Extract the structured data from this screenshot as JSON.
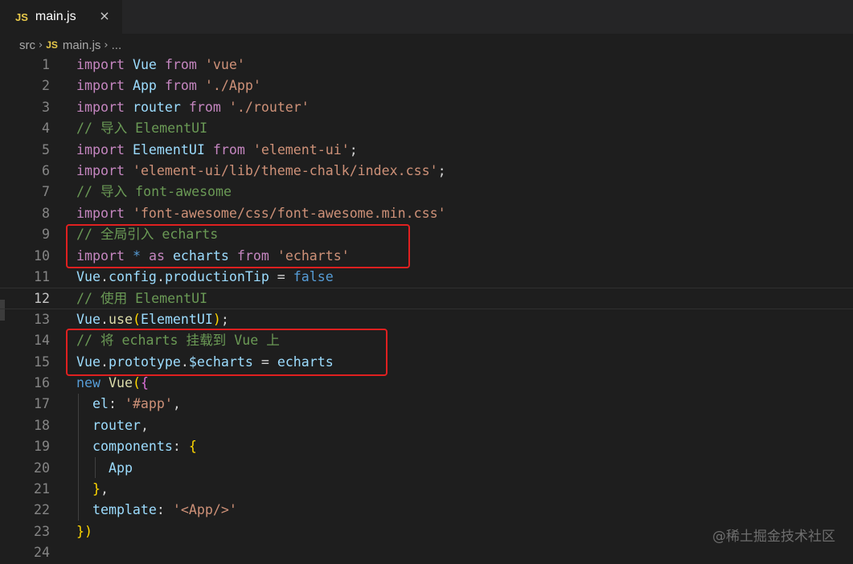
{
  "tab": {
    "badge": "JS",
    "filename": "main.js",
    "close_icon": "×"
  },
  "breadcrumb": {
    "folder": "src",
    "badge": "JS",
    "file": "main.js",
    "more": "..."
  },
  "editor": {
    "current_line": 12,
    "lines": [
      {
        "n": "1",
        "text": "import Vue from 'vue'"
      },
      {
        "n": "2",
        "text": "import App from './App'"
      },
      {
        "n": "3",
        "text": "import router from './router'"
      },
      {
        "n": "4",
        "text": "// 导入 ElementUI"
      },
      {
        "n": "5",
        "text": "import ElementUI from 'element-ui';"
      },
      {
        "n": "6",
        "text": "import 'element-ui/lib/theme-chalk/index.css';"
      },
      {
        "n": "7",
        "text": "// 导入 font-awesome"
      },
      {
        "n": "8",
        "text": "import 'font-awesome/css/font-awesome.min.css'"
      },
      {
        "n": "9",
        "text": "// 全局引入 echarts"
      },
      {
        "n": "10",
        "text": "import * as echarts from 'echarts'"
      },
      {
        "n": "11",
        "text": "Vue.config.productionTip = false"
      },
      {
        "n": "12",
        "text": "// 使用 ElementUI"
      },
      {
        "n": "13",
        "text": "Vue.use(ElementUI);"
      },
      {
        "n": "14",
        "text": "// 将 echarts 挂载到 Vue 上"
      },
      {
        "n": "15",
        "text": "Vue.prototype.$echarts = echarts"
      },
      {
        "n": "16",
        "text": "new Vue({"
      },
      {
        "n": "17",
        "text": "  el: '#app',"
      },
      {
        "n": "18",
        "text": "  router,"
      },
      {
        "n": "19",
        "text": "  components: {"
      },
      {
        "n": "20",
        "text": "    App"
      },
      {
        "n": "21",
        "text": "  },"
      },
      {
        "n": "22",
        "text": "  template: '<App/>'"
      },
      {
        "n": "23",
        "text": "})"
      },
      {
        "n": "24",
        "text": ""
      }
    ]
  },
  "watermark": "@稀土掘金技术社区",
  "colors": {
    "keyword": "#c586c0",
    "variable": "#9cdcfe",
    "string": "#ce9178",
    "comment": "#6a9955",
    "highlight_box": "#e02020"
  }
}
